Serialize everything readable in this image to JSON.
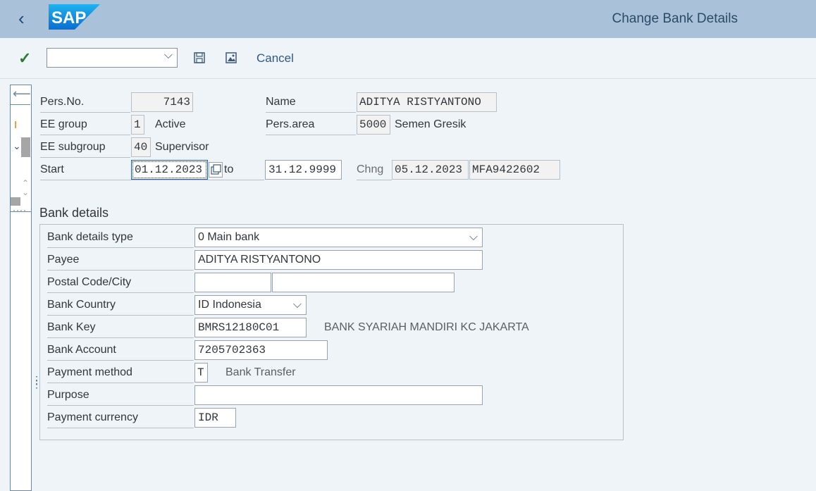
{
  "header": {
    "title": "Change Bank Details",
    "logo_text": "SAP"
  },
  "toolbar": {
    "command_value": "",
    "cancel_label": "Cancel",
    "icons": [
      "checkmark-icon",
      "save-icon",
      "picture-icon"
    ]
  },
  "personnel": {
    "persno_label": "Pers.No.",
    "persno_value": "7143",
    "name_label": "Name",
    "name_value": "ADITYA RISTYANTONO",
    "eegroup_label": "EE group",
    "eegroup_value": "1",
    "eegroup_text": "Active",
    "persarea_label": "Pers.area",
    "persarea_value": "5000",
    "persarea_text": "Semen Gresik",
    "eesubgroup_label": "EE subgroup",
    "eesubgroup_value": "40",
    "eesubgroup_text": "Supervisor",
    "start_label": "Start",
    "start_value": "01.12.2023",
    "to_label": "to",
    "to_value": "31.12.9999",
    "chng_label": "Chng",
    "chng_date": "05.12.2023",
    "chng_user": "MFA9422602"
  },
  "bank": {
    "section_title": "Bank details",
    "type_label": "Bank details type",
    "type_value": "0 Main bank",
    "payee_label": "Payee",
    "payee_value": "ADITYA RISTYANTONO",
    "postal_label": "Postal Code/City",
    "postal_value": "",
    "city_value": "",
    "country_label": "Bank Country",
    "country_value": "ID Indonesia",
    "key_label": "Bank Key",
    "key_value": "BMRS12180C01",
    "key_text": "BANK SYARIAH MANDIRI KC JAKARTA",
    "account_label": "Bank Account",
    "account_value": "7205702363",
    "method_label": "Payment method",
    "method_value": "T",
    "method_text": "Bank Transfer",
    "purpose_label": "Purpose",
    "purpose_value": "",
    "currency_label": "Payment currency",
    "currency_value": "IDR"
  }
}
